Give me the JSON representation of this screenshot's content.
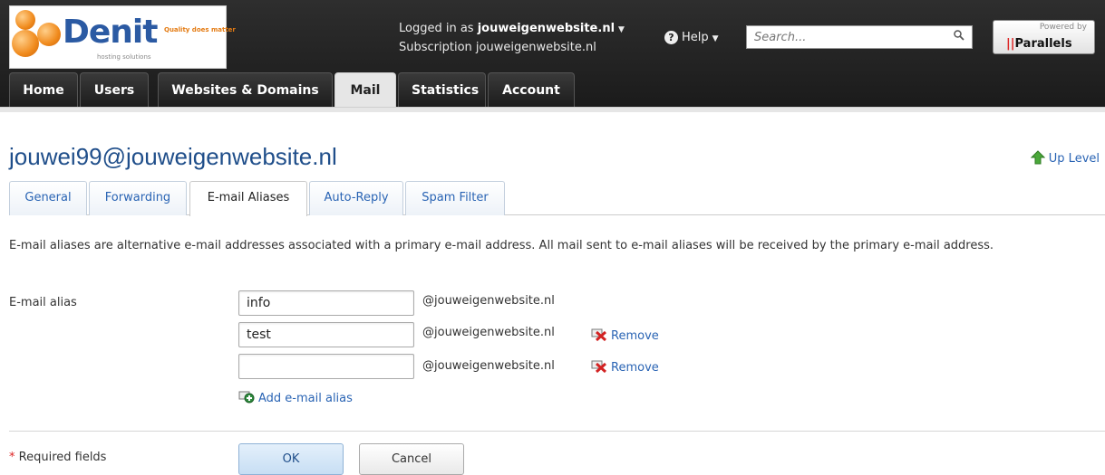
{
  "header": {
    "logo": {
      "brand": "Denit",
      "tagline": "Quality does matter",
      "subtitle": "hosting solutions"
    },
    "login": {
      "prefix": "Logged in as",
      "user": "jouweigenwebsite.nl",
      "subscription_prefix": "Subscription",
      "subscription": "jouweigenwebsite.nl"
    },
    "help_label": "Help",
    "search_placeholder": "Search...",
    "powered_by": "Powered by",
    "parallels": "Parallels"
  },
  "nav": {
    "tabs": [
      {
        "label": "Home",
        "active": false
      },
      {
        "label": "Users",
        "active": false
      },
      {
        "label": "Websites & Domains",
        "active": false
      },
      {
        "label": "Mail",
        "active": true
      },
      {
        "label": "Statistics",
        "active": false
      },
      {
        "label": "Account",
        "active": false
      }
    ]
  },
  "page": {
    "title": "jouwei99@jouweigenwebsite.nl",
    "up_level": "Up Level",
    "tabs": [
      {
        "label": "General",
        "active": false
      },
      {
        "label": "Forwarding",
        "active": false
      },
      {
        "label": "E-mail Aliases",
        "active": true
      },
      {
        "label": "Auto-Reply",
        "active": false
      },
      {
        "label": "Spam Filter",
        "active": false
      }
    ],
    "description": "E-mail aliases are alternative e-mail addresses associated with a primary e-mail address. All mail sent to e-mail aliases will be received by the primary e-mail address."
  },
  "form": {
    "alias_label": "E-mail alias",
    "domain_suffix": "@jouweigenwebsite.nl",
    "aliases": [
      {
        "value": "info",
        "removable": false
      },
      {
        "value": "test",
        "removable": true
      },
      {
        "value": "",
        "removable": true
      }
    ],
    "remove_label": "Remove",
    "add_label": "Add e-mail alias",
    "required_star": "*",
    "required_label": "Required fields",
    "ok_label": "OK",
    "cancel_label": "Cancel"
  },
  "colors": {
    "link": "#2a64b4",
    "title": "#1f4e8a",
    "header_bg": "#222222",
    "remove_icon": "#d22222",
    "add_icon": "#2e8b3d"
  }
}
